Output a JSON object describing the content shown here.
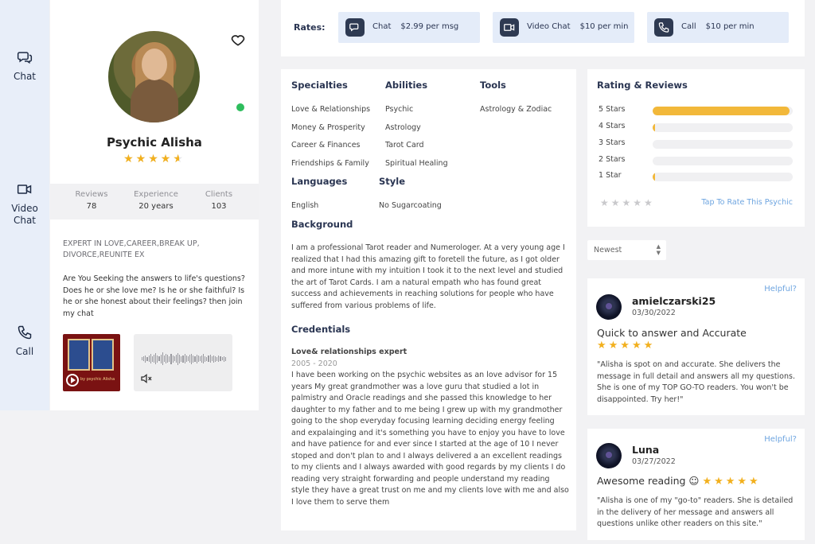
{
  "rail": {
    "chat": "Chat",
    "video_chat": "Video\nChat",
    "call": "Call"
  },
  "profile": {
    "name": "Psychic Alisha",
    "rating_stars": "★★★★★",
    "rating_value": 4.5,
    "online": true,
    "stats": [
      {
        "label": "Reviews",
        "value": "78"
      },
      {
        "label": "Experience",
        "value": "20 years"
      },
      {
        "label": "Clients",
        "value": "103"
      }
    ],
    "tagline": "EXPERT in LOVE,CAREER,BREAK UP, DIVORCE,REUNITE EX",
    "intro": "Are You Seeking the answers to life's questions? Does he or she love me? Is he or she faithful? Is he or she honest about their feelings? then join my chat",
    "video_caption": "by psychic Alisha"
  },
  "rates": {
    "label": "Rates:",
    "items": [
      {
        "name": "Chat",
        "price": "$2.99 per msg",
        "icon": "chat-icon"
      },
      {
        "name": "Video Chat",
        "price": "$10 per min",
        "icon": "video-icon"
      },
      {
        "name": "Call",
        "price": "$10 per min",
        "icon": "phone-icon"
      }
    ]
  },
  "details": {
    "specialties_title": "Specialties",
    "specialties": [
      "Love & Relationships",
      "Money & Prosperity",
      "Career & Finances",
      "Friendships & Family"
    ],
    "abilities_title": "Abilities",
    "abilities": [
      "Psychic",
      "Astrology",
      "Tarot Card",
      "Spiritual Healing"
    ],
    "tools_title": "Tools",
    "tools": [
      "Astrology & Zodiac"
    ],
    "languages_title": "Languages",
    "languages": [
      "English"
    ],
    "style_title": "Style",
    "style": [
      "No Sugarcoating"
    ],
    "background_title": "Background",
    "background": "I am a professional Tarot reader and Numerologer. At a very young age I realized that I had this amazing gift to foretell the future, as I got older and more intune with my intuition I took it to the next level and studied the art of Tarot Cards. I am a natural empath who has found great success and achievements in reaching solutions for people who have suffered from various problems of life.",
    "credentials_title": "Credentials",
    "credential_name": "Love& relationships expert",
    "credential_years": "2005 - 2020",
    "credential_text": "I have been working on the psychic websites as an love advisor for 15 years My great grandmother was a love guru that studied a lot in palmistry and Oracle readings and she passed this knowledge to her daughter to my father and to me being I grew up with my grandmother going to the shop everyday focusing learning deciding energy feeling and expalainging and it's something you have to enjoy you have to love and have patience for and ever since I started at the age of 10 I never stoped and don't plan to and I always delivered a an excellent readings to my clients and I always awarded with good regards by my clients I do reading very straight forwarding and people understand my reading style they have a great trust on me and my clients love with me and also I love them to serve them"
  },
  "ratings": {
    "title": "Rating & Reviews",
    "rows": [
      {
        "label": "5 Stars",
        "fraction": 0.98
      },
      {
        "label": "4 Stars",
        "fraction": 0.01
      },
      {
        "label": "3 Stars",
        "fraction": 0
      },
      {
        "label": "2 Stars",
        "fraction": 0
      },
      {
        "label": "1 Star",
        "fraction": 0.01
      }
    ],
    "empty_stars": "★★★★★",
    "tap_to_rate": "Tap To Rate This Psychic"
  },
  "sort": {
    "value": "Newest"
  },
  "reviews": [
    {
      "helpful": "Helpful?",
      "user": "amielczarski25",
      "date": "03/30/2022",
      "title": "Quick to answer and Accurate",
      "stars": "★★★★★",
      "rating": 5,
      "body": "\"Alisha is spot on and accurate. She delivers the message in full detail and answers all my questions. She is one of my TOP GO-TO readers. You won't be disappointed. Try her!\""
    },
    {
      "helpful": "Helpful?",
      "user": "Luna",
      "date": "03/27/2022",
      "title": "Awesome reading ☺",
      "stars": "★★★★★",
      "rating": 5,
      "body": "\"Alisha is one of my \"go-to\" readers. She is detailed in the delivery of her message and answers all questions unlike other readers on this site.\""
    }
  ]
}
